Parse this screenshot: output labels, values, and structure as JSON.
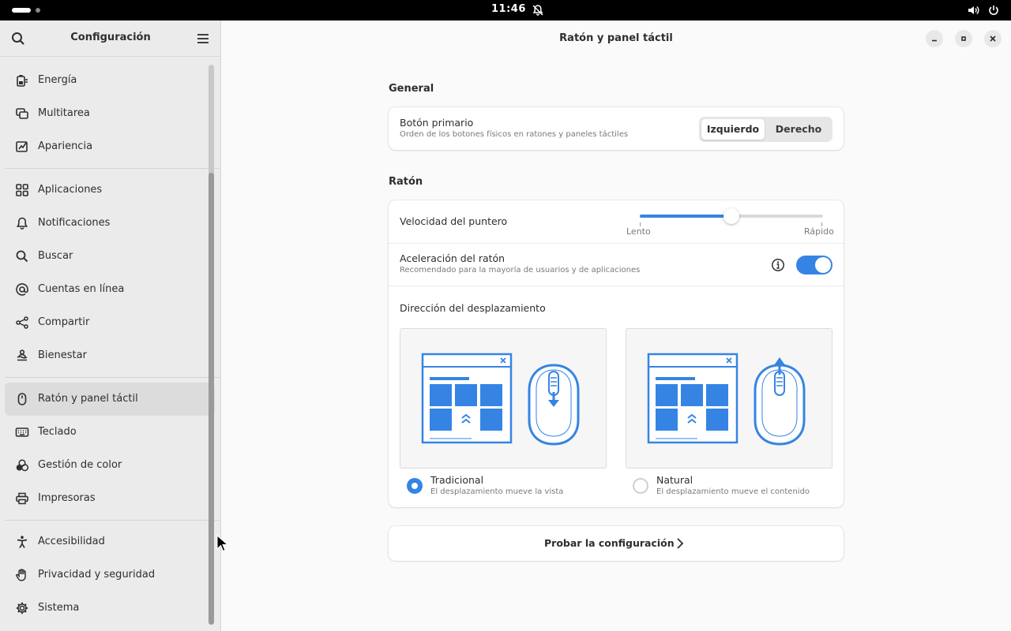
{
  "topbar": {
    "clock": "11:46"
  },
  "sidebar": {
    "title": "Configuración",
    "groups": [
      [
        {
          "label": "Energía",
          "icon": "battery-icon"
        },
        {
          "label": "Multitarea",
          "icon": "multitasking-icon"
        },
        {
          "label": "Apariencia",
          "icon": "appearance-icon"
        }
      ],
      [
        {
          "label": "Aplicaciones",
          "icon": "apps-grid-icon"
        },
        {
          "label": "Notificaciones",
          "icon": "bell-icon"
        },
        {
          "label": "Buscar",
          "icon": "search-icon"
        },
        {
          "label": "Cuentas en línea",
          "icon": "at-icon"
        },
        {
          "label": "Compartir",
          "icon": "share-icon"
        },
        {
          "label": "Bienestar",
          "icon": "wellbeing-icon"
        }
      ],
      [
        {
          "label": "Ratón y panel táctil",
          "icon": "mouse-icon",
          "active": true
        },
        {
          "label": "Teclado",
          "icon": "keyboard-icon"
        },
        {
          "label": "Gestión de color",
          "icon": "color-icon"
        },
        {
          "label": "Impresoras",
          "icon": "printer-icon"
        }
      ],
      [
        {
          "label": "Accesibilidad",
          "icon": "accessibility-icon"
        },
        {
          "label": "Privacidad y seguridad",
          "icon": "hand-icon"
        },
        {
          "label": "Sistema",
          "icon": "gear-icon"
        }
      ]
    ]
  },
  "main": {
    "title": "Ratón y panel táctil",
    "general": {
      "heading": "General",
      "primary_title": "Botón primario",
      "primary_sub": "Orden de los botones físicos en ratones y paneles táctiles",
      "left_label": "Izquierdo",
      "right_label": "Derecho",
      "selected": "Izquierdo"
    },
    "mouse": {
      "heading": "Ratón",
      "speed_title": "Velocidad del puntero",
      "speed_slow": "Lento",
      "speed_fast": "Rápido",
      "speed_value": 0.5,
      "accel_title": "Aceleración del ratón",
      "accel_sub": "Recomendado para la mayoría de usuarios y de aplicaciones",
      "accel_on": true,
      "scroll_title": "Dirección del desplazamiento",
      "traditional_title": "Tradicional",
      "traditional_sub": "El desplazamiento mueve la vista",
      "natural_title": "Natural",
      "natural_sub": "El desplazamiento mueve el contenido",
      "scroll_selected": "Tradicional"
    },
    "test_label": "Probar la configuración"
  },
  "colors": {
    "accent": "#3584e4",
    "sidebar_bg": "#ebebeb",
    "main_bg": "#fafafa"
  }
}
